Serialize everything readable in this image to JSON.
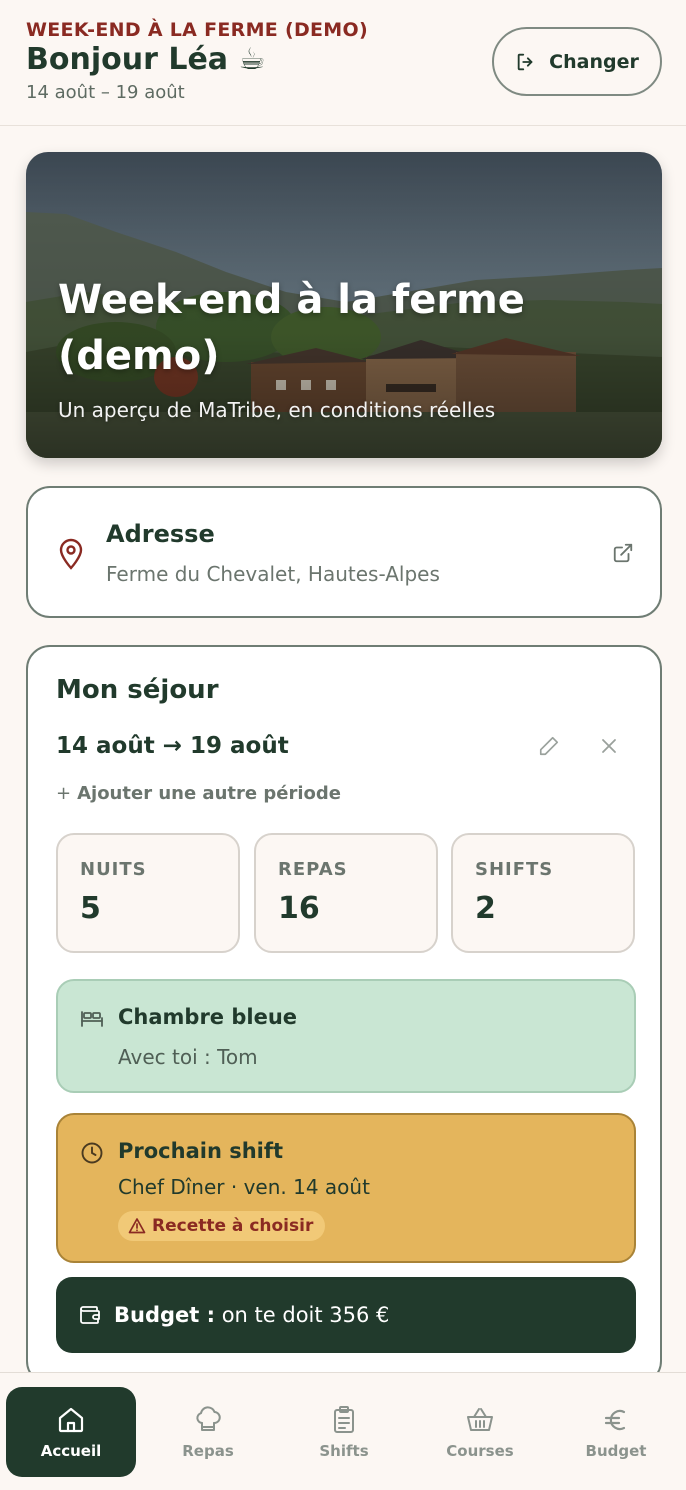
{
  "header": {
    "eyebrow": "WEEK-END À LA FERME (DEMO)",
    "greeting": "Bonjour Léa ☕",
    "dates": "14 août – 19 août",
    "change_label": "Changer"
  },
  "hero": {
    "title": "Week-end à la ferme (demo)",
    "subtitle": "Un aperçu de MaTribe, en conditions réelles"
  },
  "address": {
    "title": "Adresse",
    "value": "Ferme du Chevalet, Hautes-Alpes"
  },
  "stay": {
    "title": "Mon séjour",
    "range": "14 août → 19 août",
    "add_period": "Ajouter une autre période",
    "stats": [
      {
        "label": "NUITS",
        "value": "5"
      },
      {
        "label": "REPAS",
        "value": "16"
      },
      {
        "label": "SHIFTS",
        "value": "2"
      }
    ],
    "room": {
      "title": "Chambre bleue",
      "roommates": "Avec toi : Tom"
    },
    "shift": {
      "title": "Prochain shift",
      "detail": "Chef Dîner · ven. 14 août",
      "warning": "Recette à choisir"
    },
    "budget": {
      "label": "Budget :",
      "text": "on te doit 356 €"
    }
  },
  "nav": {
    "items": [
      {
        "label": "Accueil",
        "icon": "home-icon",
        "active": true
      },
      {
        "label": "Repas",
        "icon": "chef-hat-icon"
      },
      {
        "label": "Shifts",
        "icon": "clipboard-icon"
      },
      {
        "label": "Courses",
        "icon": "basket-icon"
      },
      {
        "label": "Budget",
        "icon": "euro-icon"
      }
    ]
  },
  "colors": {
    "primary": "#213a2c",
    "accent": "#8a2a22",
    "room_bg": "#c9e6d3",
    "shift_bg": "#e4b55c",
    "background": "#fcf7f3"
  }
}
